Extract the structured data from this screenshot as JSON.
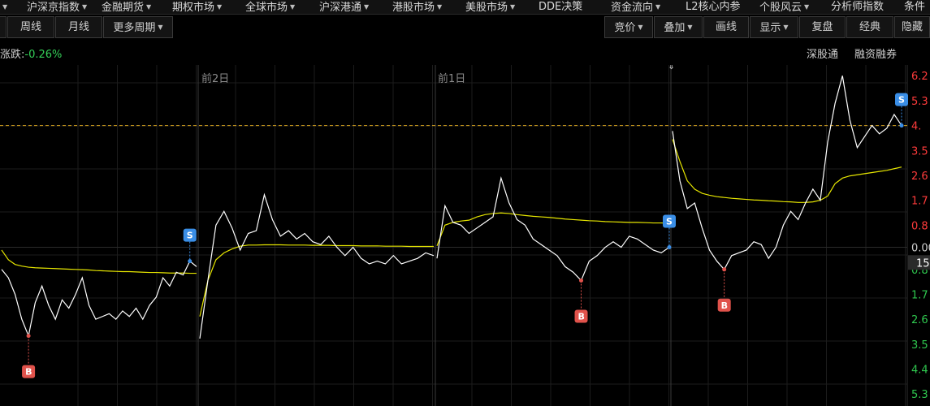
{
  "top_menu": [
    {
      "label": "沪深京指数",
      "dropdown": true
    },
    {
      "label": "金融期货",
      "dropdown": true
    },
    {
      "label": "期权市场",
      "dropdown": true
    },
    {
      "label": "全球市场",
      "dropdown": true
    },
    {
      "label": "沪深港通",
      "dropdown": true
    },
    {
      "label": "港股市场",
      "dropdown": true
    },
    {
      "label": "美股市场",
      "dropdown": true
    },
    {
      "label": "DDE决策",
      "dropdown": false
    },
    {
      "label": "资金流向",
      "dropdown": true
    },
    {
      "label": "L2核心内参",
      "dropdown": false
    },
    {
      "label": "个股风云",
      "dropdown": true
    },
    {
      "label": "分析师指数",
      "dropdown": false
    },
    {
      "label": "条件",
      "dropdown": false
    }
  ],
  "toolbar_left": [
    {
      "label": "周线",
      "dropdown": false
    },
    {
      "label": "月线",
      "dropdown": false
    },
    {
      "label": "更多周期",
      "dropdown": true
    }
  ],
  "toolbar_right": [
    {
      "label": "竞价",
      "dropdown": true
    },
    {
      "label": "叠加",
      "dropdown": true
    },
    {
      "label": "画线",
      "dropdown": false
    },
    {
      "label": "显示",
      "dropdown": true
    },
    {
      "label": "复盘",
      "dropdown": false
    },
    {
      "label": "经典",
      "dropdown": false
    },
    {
      "label": "隐藏",
      "dropdown": false
    }
  ],
  "info": {
    "change_label": "涨跌:",
    "change_value": "-0.26%",
    "links": [
      "深股通",
      "融资融券"
    ]
  },
  "colors": {
    "up": "#ff3b3b",
    "down": "#2fc84f",
    "price_line": "#ffffff",
    "avg_line": "#e6e600",
    "ref_line": "#d9a520",
    "buy_marker": "#e0524b",
    "sell_marker": "#3a8ee6"
  },
  "chart_data": {
    "type": "line",
    "day_labels": [
      "前2日",
      "前1日"
    ],
    "y_ticks": [
      {
        "value": 6.2,
        "label": "6.2"
      },
      {
        "value": 5.3,
        "label": "5.3"
      },
      {
        "value": 4.4,
        "label": "4."
      },
      {
        "value": 3.5,
        "label": "3.5"
      },
      {
        "value": 2.6,
        "label": "2.6"
      },
      {
        "value": 1.7,
        "label": "1.7"
      },
      {
        "value": 0.8,
        "label": "0.8"
      },
      {
        "value": 0.0,
        "label": "0.00"
      },
      {
        "value": -0.8,
        "label": "0.8"
      },
      {
        "value": -1.7,
        "label": "1.7"
      },
      {
        "value": -2.6,
        "label": "2.6"
      },
      {
        "value": -3.5,
        "label": "3.5"
      },
      {
        "value": -4.4,
        "label": "4.4"
      },
      {
        "value": -5.3,
        "label": "5.3"
      }
    ],
    "current_tag": "15",
    "ylim": [
      -5.5,
      6.5
    ],
    "days": [
      {
        "price": [
          -0.8,
          -1.1,
          -1.7,
          -2.6,
          -3.2,
          -2.0,
          -1.4,
          -2.1,
          -2.6,
          -1.9,
          -2.2,
          -1.7,
          -1.1,
          -2.1,
          -2.6,
          -2.5,
          -2.4,
          -2.6,
          -2.3,
          -2.5,
          -2.2,
          -2.6,
          -2.1,
          -1.8,
          -1.1,
          -1.4,
          -0.9,
          -1.0,
          -0.5,
          -0.7
        ],
        "avg": [
          -0.1,
          -0.45,
          -0.62,
          -0.68,
          -0.72,
          -0.74,
          -0.75,
          -0.76,
          -0.77,
          -0.78,
          -0.79,
          -0.8,
          -0.81,
          -0.82,
          -0.84,
          -0.85,
          -0.86,
          -0.87,
          -0.88,
          -0.88,
          -0.89,
          -0.9,
          -0.91,
          -0.91,
          -0.92,
          -0.93,
          -0.93,
          -0.93,
          -0.94,
          -0.94
        ]
      },
      {
        "price": [
          -3.3,
          -1.2,
          0.8,
          1.3,
          0.7,
          -0.1,
          0.5,
          0.6,
          1.9,
          1.0,
          0.4,
          0.6,
          0.3,
          0.5,
          0.2,
          0.1,
          0.4,
          0.0,
          -0.3,
          0.0,
          -0.4,
          -0.6,
          -0.5,
          -0.6,
          -0.3,
          -0.6,
          -0.5,
          -0.4,
          -0.2,
          -0.3
        ],
        "avg": [
          -2.5,
          -1.2,
          -0.45,
          -0.2,
          -0.06,
          0.04,
          0.08,
          0.08,
          0.09,
          0.09,
          0.09,
          0.08,
          0.08,
          0.08,
          0.07,
          0.07,
          0.07,
          0.06,
          0.06,
          0.06,
          0.05,
          0.05,
          0.05,
          0.04,
          0.04,
          0.04,
          0.03,
          0.03,
          0.03,
          0.03
        ]
      },
      {
        "price": [
          -0.4,
          1.5,
          0.9,
          0.8,
          0.5,
          0.7,
          0.9,
          1.1,
          2.5,
          1.6,
          1.0,
          0.8,
          0.3,
          0.1,
          -0.1,
          -0.3,
          -0.7,
          -0.9,
          -1.2,
          -0.5,
          -0.3,
          0.0,
          0.2,
          0.0,
          0.4,
          0.3,
          0.1,
          -0.1,
          -0.2,
          0.0
        ],
        "avg": [
          0.05,
          0.8,
          0.9,
          0.95,
          0.98,
          1.1,
          1.18,
          1.22,
          1.24,
          1.22,
          1.18,
          1.15,
          1.12,
          1.1,
          1.08,
          1.05,
          1.02,
          1.0,
          0.98,
          0.96,
          0.95,
          0.93,
          0.92,
          0.91,
          0.9,
          0.9,
          0.89,
          0.88,
          0.88,
          0.87
        ]
      },
      {
        "price": [
          4.2,
          2.4,
          1.4,
          1.6,
          0.7,
          -0.1,
          -0.5,
          -0.8,
          -0.3,
          -0.2,
          -0.1,
          0.2,
          0.1,
          -0.4,
          0.0,
          0.8,
          1.3,
          1.0,
          1.6,
          2.1,
          1.7,
          3.8,
          5.2,
          6.2,
          4.6,
          3.6,
          4.0,
          4.4,
          4.1,
          4.3,
          4.8,
          4.4
        ],
        "avg": [
          3.9,
          3.1,
          2.4,
          2.1,
          1.95,
          1.88,
          1.83,
          1.8,
          1.77,
          1.75,
          1.73,
          1.71,
          1.7,
          1.68,
          1.67,
          1.65,
          1.64,
          1.62,
          1.62,
          1.64,
          1.7,
          1.85,
          2.3,
          2.5,
          2.58,
          2.62,
          2.66,
          2.7,
          2.74,
          2.78,
          2.84,
          2.9
        ]
      }
    ],
    "signals": [
      {
        "type": "B",
        "day": 0,
        "index": 4
      },
      {
        "type": "S",
        "day": 0,
        "index": 28
      },
      {
        "type": "B",
        "day": 2,
        "index": 18
      },
      {
        "type": "S",
        "day": 2,
        "index": 29
      },
      {
        "type": "B",
        "day": 3,
        "index": 7
      },
      {
        "type": "S",
        "day": 3,
        "index": 31
      }
    ],
    "ref_line_value": 4.4
  }
}
